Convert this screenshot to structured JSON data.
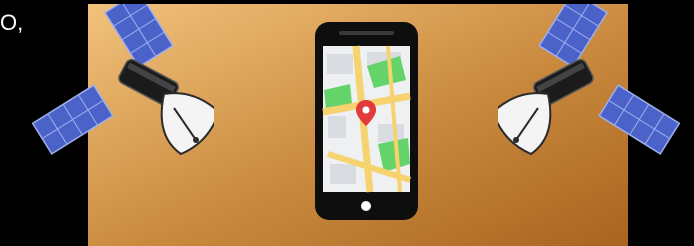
{
  "caption": {
    "visible_text": "O,"
  },
  "illustration": {
    "background_gradient": [
      "#f2c27c",
      "#c98a3e",
      "#a9641f"
    ],
    "phone_color": "#0e0e0e",
    "map_colors": {
      "base": "#eef0f2",
      "roads": "#f6d36f",
      "parks": "#63d36a",
      "blocks": "#d9dde1",
      "pin": "#e03a3a"
    },
    "icons": [
      "satellite-left-icon",
      "smartphone-icon",
      "map-pin-icon",
      "satellite-right-icon"
    ]
  }
}
